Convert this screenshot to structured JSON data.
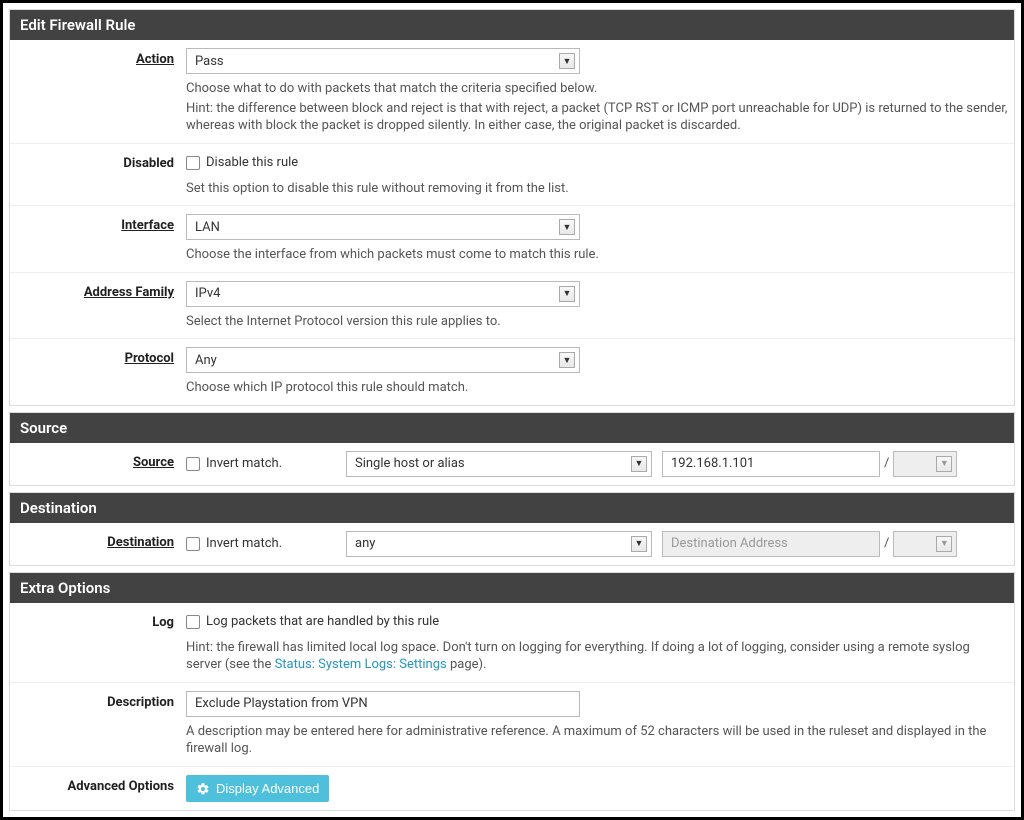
{
  "sections": {
    "edit": "Edit Firewall Rule",
    "source": "Source",
    "destination": "Destination",
    "extra": "Extra Options"
  },
  "action": {
    "label": "Action",
    "value": "Pass",
    "help1": "Choose what to do with packets that match the criteria specified below.",
    "help2": "Hint: the difference between block and reject is that with reject, a packet (TCP RST or ICMP port unreachable for UDP) is returned to the sender, whereas with block the packet is dropped silently. In either case, the original packet is discarded."
  },
  "disabled": {
    "label": "Disabled",
    "checkbox_label": "Disable this rule",
    "help": "Set this option to disable this rule without removing it from the list."
  },
  "interface": {
    "label": "Interface",
    "value": "LAN",
    "help": "Choose the interface from which packets must come to match this rule."
  },
  "addrfam": {
    "label": "Address Family",
    "value": "IPv4",
    "help": "Select the Internet Protocol version this rule applies to."
  },
  "protocol": {
    "label": "Protocol",
    "value": "Any",
    "help": "Choose which IP protocol this rule should match."
  },
  "source": {
    "label": "Source",
    "invert_label": "Invert match.",
    "type": "Single host or alias",
    "address": "192.168.1.101",
    "separator": "/",
    "mask": ""
  },
  "destination": {
    "label": "Destination",
    "invert_label": "Invert match.",
    "type": "any",
    "address_placeholder": "Destination Address",
    "separator": "/",
    "mask": ""
  },
  "log": {
    "label": "Log",
    "checkbox_label": "Log packets that are handled by this rule",
    "help_prefix": "Hint: the firewall has limited local log space. Don't turn on logging for everything. If doing a lot of logging, consider using a remote syslog server (see the ",
    "help_link": "Status: System Logs: Settings",
    "help_suffix": " page)."
  },
  "description": {
    "label": "Description",
    "value": "Exclude Playstation from VPN",
    "help": "A description may be entered here for administrative reference. A maximum of 52 characters will be used in the ruleset and displayed in the firewall log."
  },
  "advanced": {
    "label": "Advanced Options",
    "button": "Display Advanced"
  }
}
